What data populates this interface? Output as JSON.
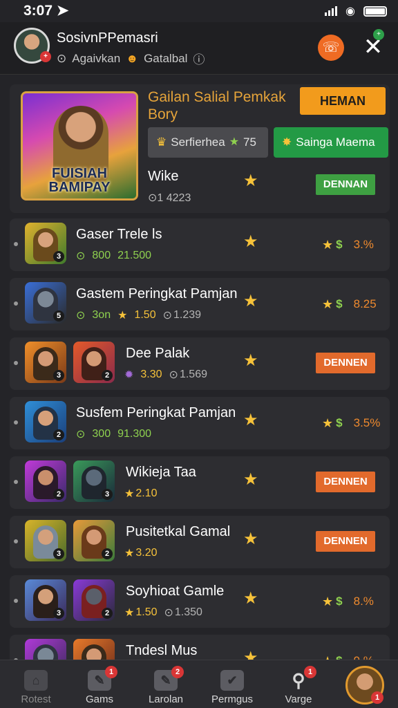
{
  "status": {
    "time": "3:07"
  },
  "header": {
    "name": "SosivnPPemasri",
    "sub1": "Agaivkan",
    "sub2": "Gatalbal"
  },
  "featured": {
    "title": "Gailan Salial Pemkak Bory",
    "image_caption": "FUISIAH BAMIPAY",
    "primary_button": "HEMAN",
    "pill_grey_label": "Serfierhea",
    "pill_grey_value": "75",
    "pill_green_label": "Sainga Maema",
    "item_title": "Wike",
    "item_count": "1 4223",
    "item_button": "DENNAN"
  },
  "rows": [
    {
      "title": "Gaser Trele ls",
      "sub_a": "800",
      "sub_b": "21.500",
      "pct": "3.%",
      "button": ""
    },
    {
      "title": "Gastem Peringkat Pamjan",
      "sub_a": "3on",
      "sub_b": "1.50",
      "sub_c": "1.239",
      "pct": "8.25",
      "button": ""
    },
    {
      "title": "Dee Palak",
      "sub_a": "3.30",
      "sub_c": "1.569",
      "pct": "",
      "button": "DENNEN"
    },
    {
      "title": "Susfem Peringkat Pamjan",
      "sub_a": "300",
      "sub_b": "91.300",
      "pct": "3.5%",
      "button": ""
    },
    {
      "title": "Wikieja Taa",
      "sub_a": "2.10",
      "pct": "",
      "button": "DENNEN"
    },
    {
      "title": "Pusitetkal Gamal",
      "sub_a": "3.20",
      "pct": "",
      "button": "DENNEN"
    },
    {
      "title": "Soyhioat Gamle",
      "sub_a": "1.50",
      "sub_c": "1.350",
      "pct": "8.%",
      "button": ""
    },
    {
      "title": "Tndesl Mus",
      "pct": "9.%",
      "button": ""
    }
  ],
  "tabs": [
    {
      "label": "Rotest",
      "badge": ""
    },
    {
      "label": "Gams",
      "badge": "1"
    },
    {
      "label": "Larolan",
      "badge": "2"
    },
    {
      "label": "Permgus",
      "badge": ""
    },
    {
      "label": "Varge",
      "badge": "1"
    }
  ],
  "profile_tab_badge": "1",
  "colors": {
    "accent_orange": "#f29b1c",
    "accent_green": "#239a45",
    "button_red": "#e26a2c",
    "star": "#f6c23a"
  }
}
